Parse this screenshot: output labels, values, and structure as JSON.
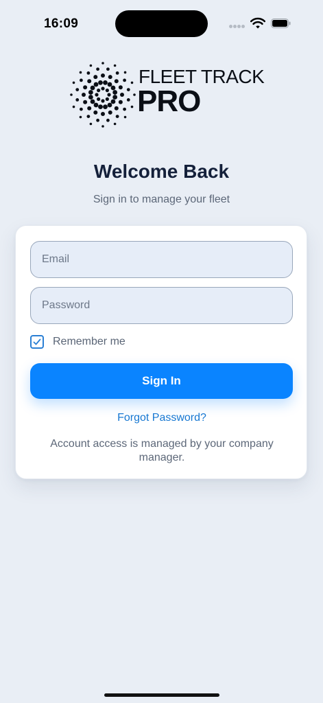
{
  "status_bar": {
    "time": "16:09",
    "icons": [
      "signal-dots-icon",
      "wifi-icon",
      "battery-icon"
    ]
  },
  "logo": {
    "line1": "FLEET TRACK",
    "line2": "PRO",
    "icon": "radial-dots-logo-icon"
  },
  "header": {
    "title": "Welcome Back",
    "subtitle": "Sign in to manage your fleet"
  },
  "form": {
    "email_placeholder": "Email",
    "email_value": "",
    "password_placeholder": "Password",
    "password_value": "",
    "remember_label": "Remember me",
    "remember_checked": true,
    "sign_in_label": "Sign In",
    "forgot_label": "Forgot Password?",
    "note": "Account access is managed by your company manager."
  },
  "colors": {
    "background": "#e9eef5",
    "accent": "#0a84ff",
    "link": "#1677d2",
    "field_bg": "#e6edf8"
  }
}
